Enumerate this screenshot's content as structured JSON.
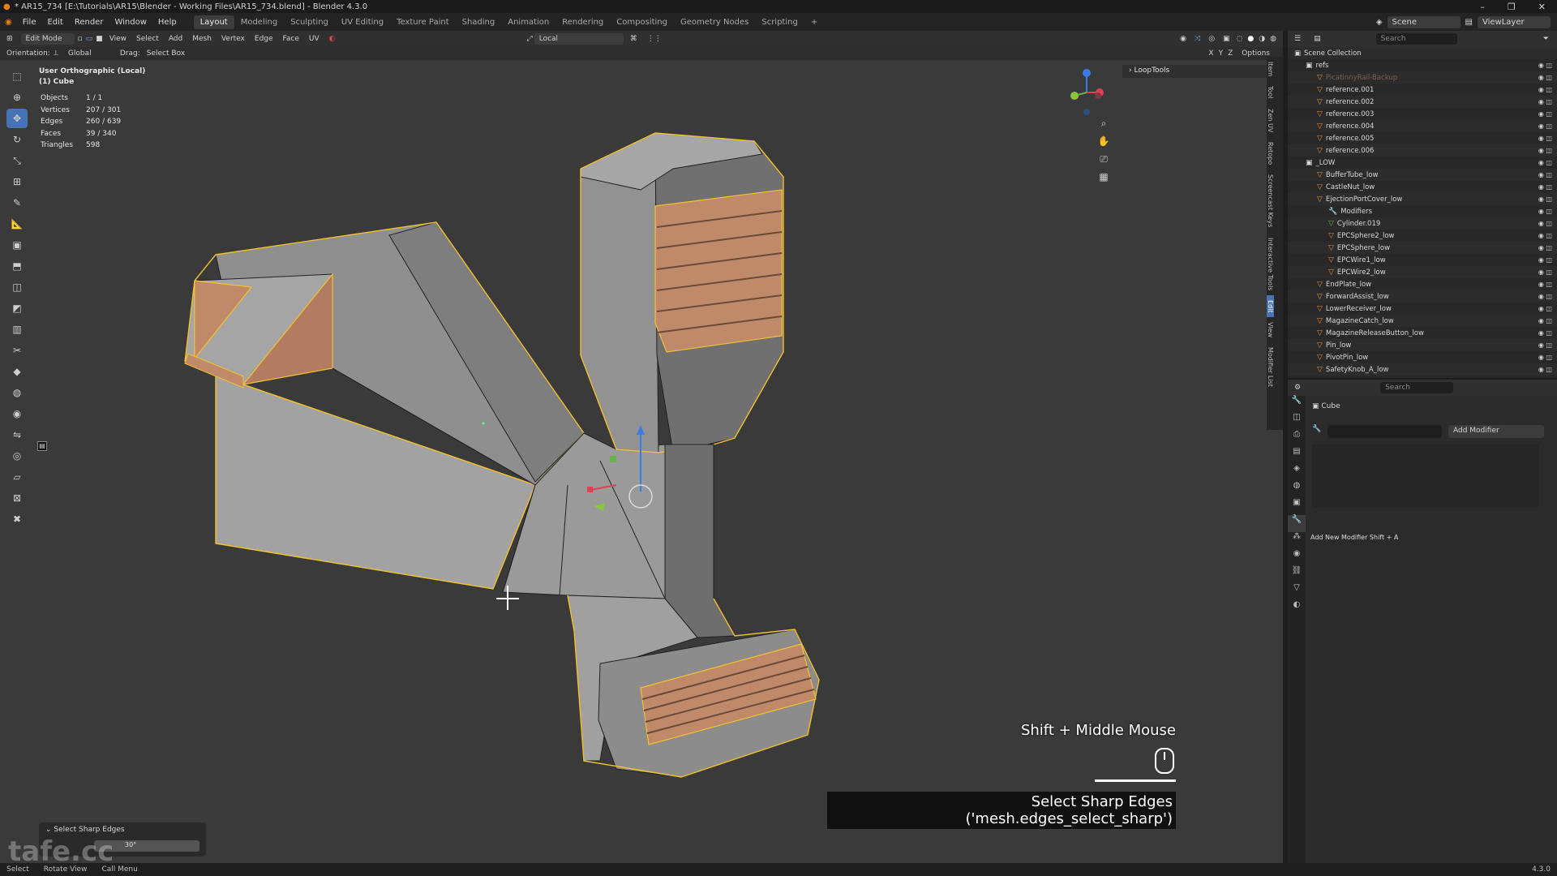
{
  "window": {
    "title": "* AR15_734 [E:\\Tutorials\\AR15\\Blender - Working Files\\AR15_734.blend] - Blender 4.3.0",
    "controls": [
      "–",
      "❐",
      "✕"
    ]
  },
  "menu": {
    "items": [
      "File",
      "Edit",
      "Render",
      "Window",
      "Help"
    ],
    "workspaces": [
      "Layout",
      "Modeling",
      "Sculpting",
      "UV Editing",
      "Texture Paint",
      "Shading",
      "Animation",
      "Rendering",
      "Compositing",
      "Geometry Nodes",
      "Scripting"
    ],
    "active_workspace": "Layout",
    "scene": "Scene",
    "view_layer": "ViewLayer"
  },
  "viewport_header": {
    "mode": "Edit Mode",
    "menus": [
      "View",
      "Select",
      "Add",
      "Mesh",
      "Vertex",
      "Edge",
      "Face",
      "UV"
    ],
    "pivot": "Local",
    "options": "Options",
    "orientation_label": "Orientation:",
    "orientation_value": "Global",
    "drag_label": "Drag:",
    "drag_value": "Select Box"
  },
  "overlay": {
    "view_name": "User Orthographic (Local)",
    "object_name": "(1) Cube",
    "stats": [
      {
        "label": "Objects",
        "value": "1 / 1"
      },
      {
        "label": "Vertices",
        "value": "207 / 301"
      },
      {
        "label": "Edges",
        "value": "260 / 639"
      },
      {
        "label": "Faces",
        "value": "39 / 340"
      },
      {
        "label": "Triangles",
        "value": "598"
      }
    ]
  },
  "sidebar": {
    "panel_title": "LoopTools",
    "tabs": [
      "Item",
      "Tool",
      "Zen UV",
      "Retopo",
      "Screencast Keys",
      "Interactive Tools",
      "Edit",
      "View",
      "Modifier List"
    ],
    "active_tab": "Edit"
  },
  "key_hint": {
    "keys": "Shift + Middle Mouse",
    "operator": "Select Sharp Edges ('mesh.edges_select_sharp')"
  },
  "operator_panel": {
    "title": "Select Sharp Edges",
    "value": "30°"
  },
  "watermark": "tafe.cc",
  "statusbar": {
    "items": [
      "Select",
      "Rotate View",
      "Call Menu"
    ],
    "version": "4.3.0"
  },
  "outliner": {
    "search_placeholder": "Search",
    "root": "Scene Collection",
    "rows": [
      {
        "name": "refs",
        "kind": "collection",
        "indent": 1
      },
      {
        "name": "PicatinnyRail-Backup",
        "kind": "object",
        "indent": 2,
        "dim": true
      },
      {
        "name": "reference.001",
        "kind": "object",
        "indent": 2
      },
      {
        "name": "reference.002",
        "kind": "object",
        "indent": 2
      },
      {
        "name": "reference.003",
        "kind": "object",
        "indent": 2
      },
      {
        "name": "reference.004",
        "kind": "object",
        "indent": 2
      },
      {
        "name": "reference.005",
        "kind": "object",
        "indent": 2
      },
      {
        "name": "reference.006",
        "kind": "object",
        "indent": 2
      },
      {
        "name": "_LOW",
        "kind": "collection",
        "indent": 1
      },
      {
        "name": "BufferTube_low",
        "kind": "object",
        "indent": 2
      },
      {
        "name": "CastleNut_low",
        "kind": "object",
        "indent": 2
      },
      {
        "name": "EjectionPortCover_low",
        "kind": "object",
        "indent": 2
      },
      {
        "name": "Modifiers",
        "kind": "modifier",
        "indent": 3
      },
      {
        "name": "Cylinder.019",
        "kind": "mesh",
        "indent": 3
      },
      {
        "name": "EPCSphere2_low",
        "kind": "object",
        "indent": 3
      },
      {
        "name": "EPCSphere_low",
        "kind": "object",
        "indent": 3
      },
      {
        "name": "EPCWire1_low",
        "kind": "object",
        "indent": 3
      },
      {
        "name": "EPCWire2_low",
        "kind": "object",
        "indent": 3
      },
      {
        "name": "EndPlate_low",
        "kind": "object",
        "indent": 2
      },
      {
        "name": "ForwardAssist_low",
        "kind": "object",
        "indent": 2
      },
      {
        "name": "LowerReceiver_low",
        "kind": "object",
        "indent": 2
      },
      {
        "name": "MagazineCatch_low",
        "kind": "object",
        "indent": 2
      },
      {
        "name": "MagazineReleaseButton_low",
        "kind": "object",
        "indent": 2
      },
      {
        "name": "Pin_low",
        "kind": "object",
        "indent": 2
      },
      {
        "name": "PivotPin_low",
        "kind": "object",
        "indent": 2
      },
      {
        "name": "SafetyKnob_A_low",
        "kind": "object",
        "indent": 2
      }
    ]
  },
  "properties": {
    "search_placeholder": "Search",
    "object_name": "Cube",
    "add_modifier": "Add Modifier",
    "note": "Add New Modifier Shift + A"
  },
  "colors": {
    "selection": "#f2c12e",
    "face_selected": "#c08a6a",
    "mesh_face": "#a3a3a3",
    "viewport_bg": "#3a3a3a",
    "accent": "#4772b3"
  }
}
